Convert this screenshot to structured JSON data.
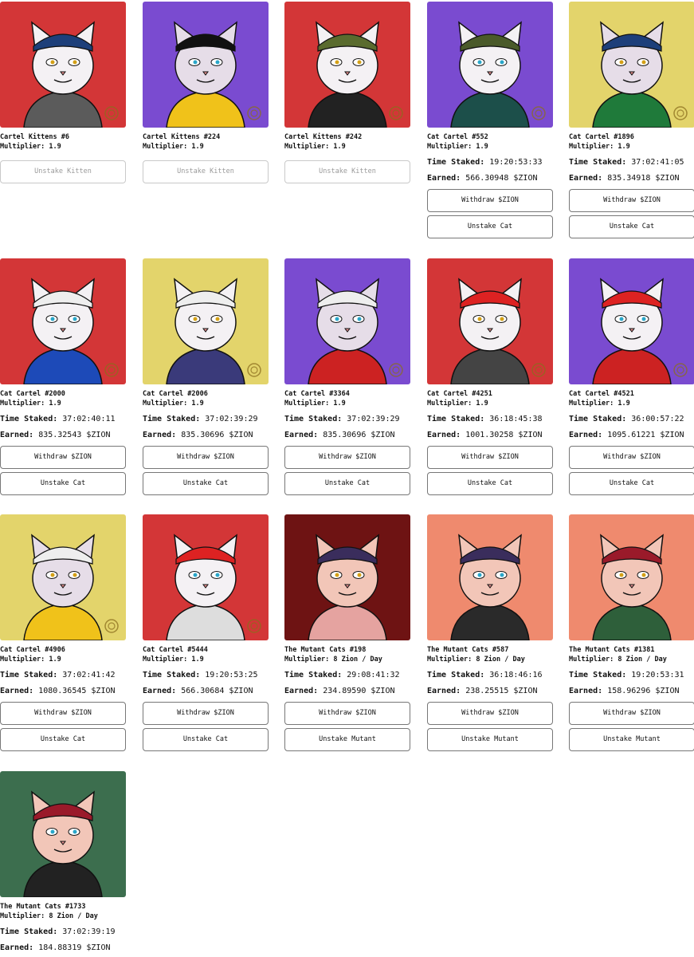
{
  "colors": {
    "red": "#d33637",
    "purple": "#7a4bd0",
    "yellow": "#e3d46b",
    "darkred": "#6e1313",
    "salmon": "#ef8a6e",
    "green": "#3c6e4e"
  },
  "cards": [
    {
      "name": "Cartel Kittens #6",
      "multiplier": "Multiplier: 1.9",
      "unstake_label": "Unstake Kitten",
      "bg": "#d33637"
    },
    {
      "name": "Cartel Kittens #224",
      "multiplier": "Multiplier: 1.9",
      "unstake_label": "Unstake Kitten",
      "bg": "#7a4bd0"
    },
    {
      "name": "Cartel Kittens #242",
      "multiplier": "Multiplier: 1.9",
      "unstake_label": "Unstake Kitten",
      "bg": "#d33637"
    },
    {
      "name": "Cat Cartel #552",
      "multiplier": "Multiplier: 1.9",
      "time_label": "Time Staked:",
      "time_value": "19:20:53:33",
      "earned_label": "Earned:",
      "earned_value": "566.30948 $ZION",
      "withdraw_label": "Withdraw $ZION",
      "unstake_label": "Unstake Cat",
      "bg": "#7a4bd0"
    },
    {
      "name": "Cat Cartel #1896",
      "multiplier": "Multiplier: 1.9",
      "time_label": "Time Staked:",
      "time_value": "37:02:41:05",
      "earned_label": "Earned:",
      "earned_value": "835.34918 $ZION",
      "withdraw_label": "Withdraw $ZION",
      "unstake_label": "Unstake Cat",
      "bg": "#e3d46b"
    },
    {
      "name": "Cat Cartel #2000",
      "multiplier": "Multiplier: 1.9",
      "time_label": "Time Staked:",
      "time_value": "37:02:40:11",
      "earned_label": "Earned:",
      "earned_value": "835.32543 $ZION",
      "withdraw_label": "Withdraw $ZION",
      "unstake_label": "Unstake Cat",
      "bg": "#d33637"
    },
    {
      "name": "Cat Cartel #2006",
      "multiplier": "Multiplier: 1.9",
      "time_label": "Time Staked:",
      "time_value": "37:02:39:29",
      "earned_label": "Earned:",
      "earned_value": "835.30696 $ZION",
      "withdraw_label": "Withdraw $ZION",
      "unstake_label": "Unstake Cat",
      "bg": "#e3d46b"
    },
    {
      "name": "Cat Cartel #3364",
      "multiplier": "Multiplier: 1.9",
      "time_label": "Time Staked:",
      "time_value": "37:02:39:29",
      "earned_label": "Earned:",
      "earned_value": "835.30696 $ZION",
      "withdraw_label": "Withdraw $ZION",
      "unstake_label": "Unstake Cat",
      "bg": "#7a4bd0"
    },
    {
      "name": "Cat Cartel #4251",
      "multiplier": "Multiplier: 1.9",
      "time_label": "Time Staked:",
      "time_value": "36:18:45:38",
      "earned_label": "Earned:",
      "earned_value": "1001.30258 $ZION",
      "withdraw_label": "Withdraw $ZION",
      "unstake_label": "Unstake Cat",
      "bg": "#d33637"
    },
    {
      "name": "Cat Cartel #4521",
      "multiplier": "Multiplier: 1.9",
      "time_label": "Time Staked:",
      "time_value": "36:00:57:22",
      "earned_label": "Earned:",
      "earned_value": "1095.61221 $ZION",
      "withdraw_label": "Withdraw $ZION",
      "unstake_label": "Unstake Cat",
      "bg": "#7a4bd0"
    },
    {
      "name": "Cat Cartel #4906",
      "multiplier": "Multiplier: 1.9",
      "time_label": "Time Staked:",
      "time_value": "37:02:41:42",
      "earned_label": "Earned:",
      "earned_value": "1080.36545 $ZION",
      "withdraw_label": "Withdraw $ZION",
      "unstake_label": "Unstake Cat",
      "bg": "#e3d46b"
    },
    {
      "name": "Cat Cartel #5444",
      "multiplier": "Multiplier: 1.9",
      "time_label": "Time Staked:",
      "time_value": "19:20:53:25",
      "earned_label": "Earned:",
      "earned_value": "566.30684 $ZION",
      "withdraw_label": "Withdraw $ZION",
      "unstake_label": "Unstake Cat",
      "bg": "#d33637"
    },
    {
      "name": "The Mutant Cats #198",
      "multiplier": "Multiplier: 8 Zion / Day",
      "time_label": "Time Staked:",
      "time_value": "29:08:41:32",
      "earned_label": "Earned:",
      "earned_value": "234.89590 $ZION",
      "withdraw_label": "Withdraw $ZION",
      "unstake_label": "Unstake Mutant",
      "bg": "#6e1313"
    },
    {
      "name": "The Mutant Cats #587",
      "multiplier": "Multiplier: 8 Zion / Day",
      "time_label": "Time Staked:",
      "time_value": "36:18:46:16",
      "earned_label": "Earned:",
      "earned_value": "238.25515 $ZION",
      "withdraw_label": "Withdraw $ZION",
      "unstake_label": "Unstake Mutant",
      "bg": "#ef8a6e"
    },
    {
      "name": "The Mutant Cats #1381",
      "multiplier": "Multiplier: 8 Zion / Day",
      "time_label": "Time Staked:",
      "time_value": "19:20:53:31",
      "earned_label": "Earned:",
      "earned_value": "158.96296 $ZION",
      "withdraw_label": "Withdraw $ZION",
      "unstake_label": "Unstake Mutant",
      "bg": "#ef8a6e"
    },
    {
      "name": "The Mutant Cats #1733",
      "multiplier": "Multiplier: 8 Zion / Day",
      "time_label": "Time Staked:",
      "time_value": "37:02:39:19",
      "earned_label": "Earned:",
      "earned_value": "184.88319 $ZION",
      "bg": "#3c6e4e"
    }
  ]
}
